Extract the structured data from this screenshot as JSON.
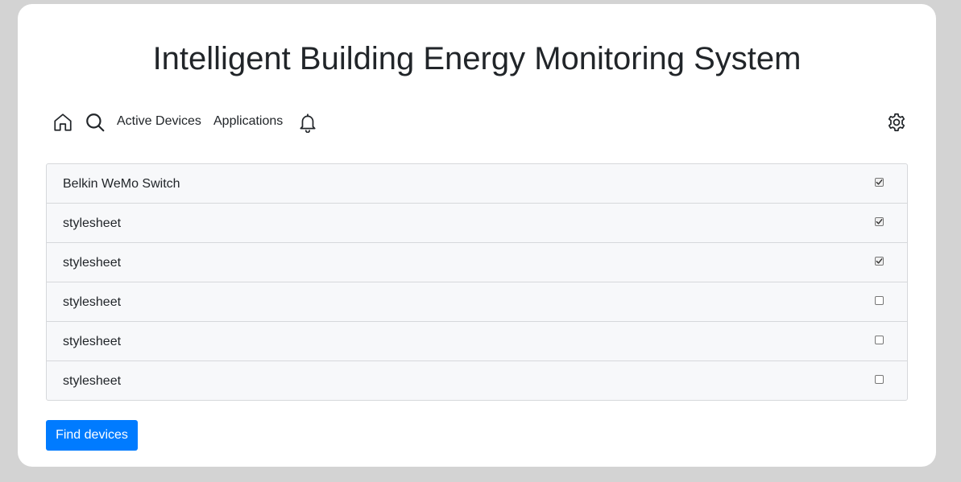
{
  "app": {
    "title": "Intelligent Building Energy Monitoring System"
  },
  "nav": {
    "home_icon": "home-icon",
    "search_icon": "search-icon",
    "active_devices_label": "Active Devices",
    "applications_label": "Applications",
    "notifications_icon": "bell-icon",
    "settings_icon": "gear-icon"
  },
  "devices": [
    {
      "name": "Belkin WeMo Switch",
      "checked": true
    },
    {
      "name": "stylesheet",
      "checked": true
    },
    {
      "name": "stylesheet",
      "checked": true
    },
    {
      "name": "stylesheet",
      "checked": false
    },
    {
      "name": "stylesheet",
      "checked": false
    },
    {
      "name": "stylesheet",
      "checked": false
    }
  ],
  "actions": {
    "find_devices_label": "Find devices"
  },
  "colors": {
    "page_background": "#d3d3d3",
    "card_background": "#ffffff",
    "primary": "#007bff",
    "list_background": "#f7f8fa",
    "text": "#212529"
  }
}
